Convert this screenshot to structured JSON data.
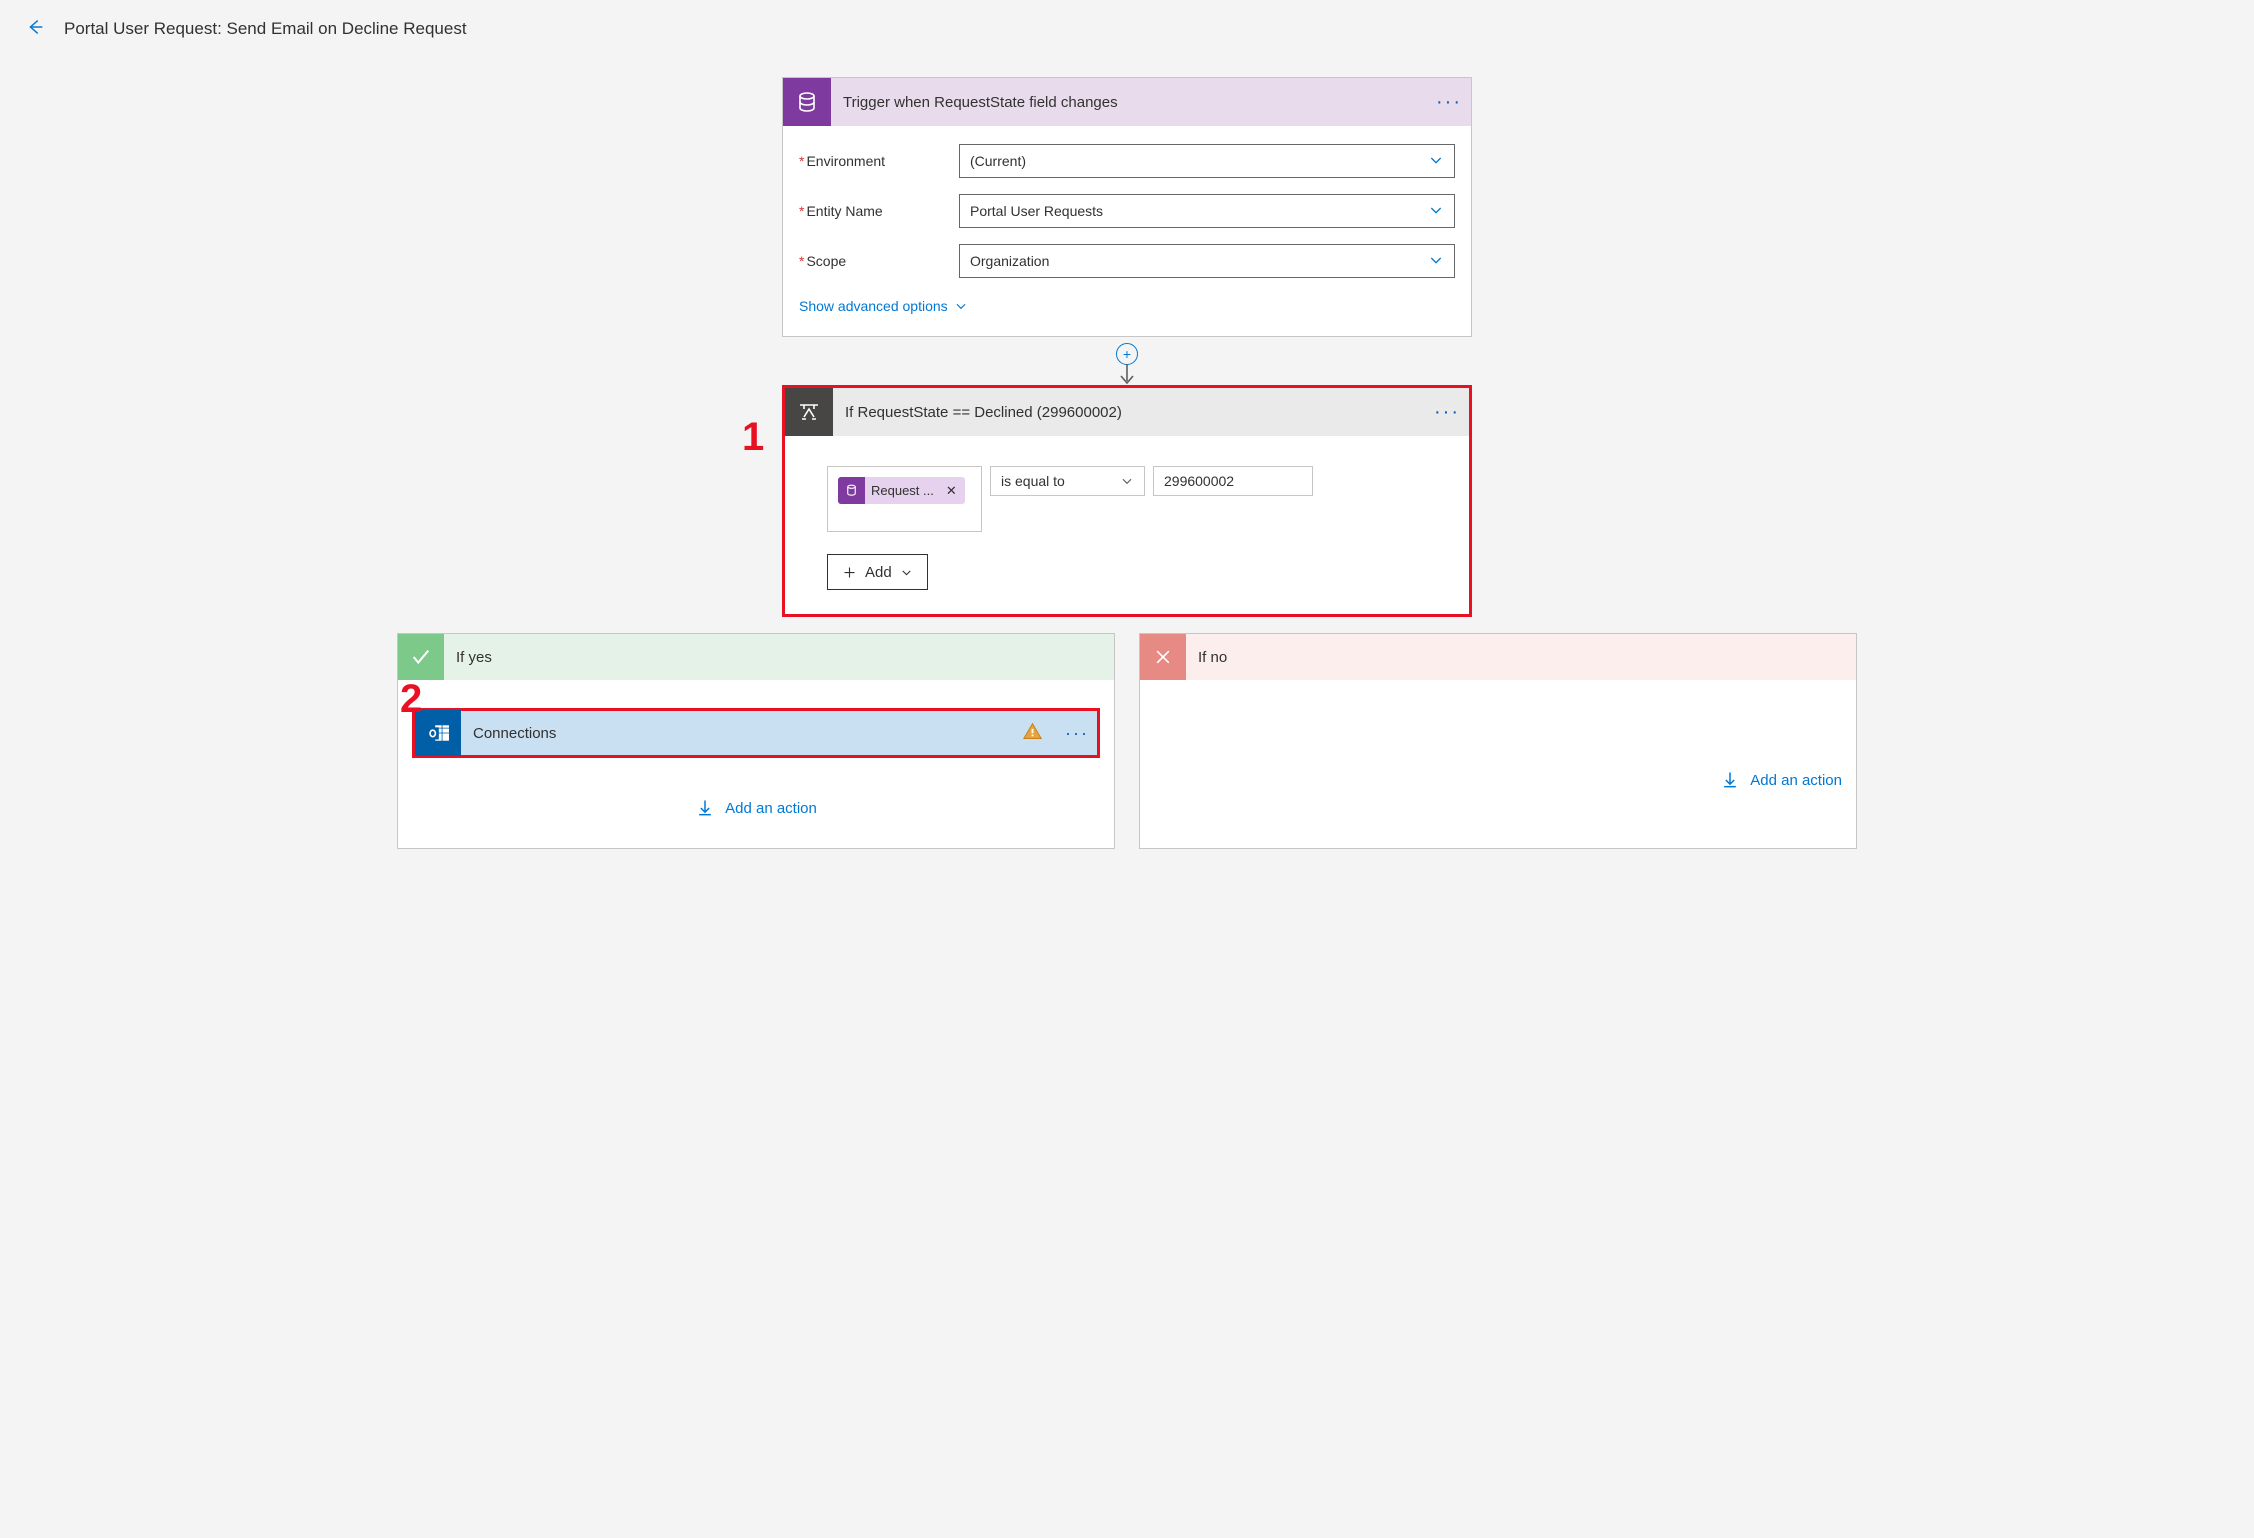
{
  "header": {
    "page_title": "Portal User Request: Send Email on Decline Request"
  },
  "trigger": {
    "title": "Trigger when RequestState field changes",
    "fields": {
      "environment": {
        "label": "Environment",
        "value": "(Current)"
      },
      "entity": {
        "label": "Entity Name",
        "value": "Portal User Requests"
      },
      "scope": {
        "label": "Scope",
        "value": "Organization"
      }
    },
    "advanced": "Show advanced options"
  },
  "condition": {
    "title": "If RequestState == Declined (299600002)",
    "token_label": "Request ...",
    "operator": "is equal to",
    "value": "299600002",
    "add_label": "Add"
  },
  "branches": {
    "yes_label": "If yes",
    "no_label": "If no",
    "connections_label": "Connections",
    "add_action": "Add an action"
  },
  "callouts": {
    "one": "1",
    "two": "2"
  }
}
